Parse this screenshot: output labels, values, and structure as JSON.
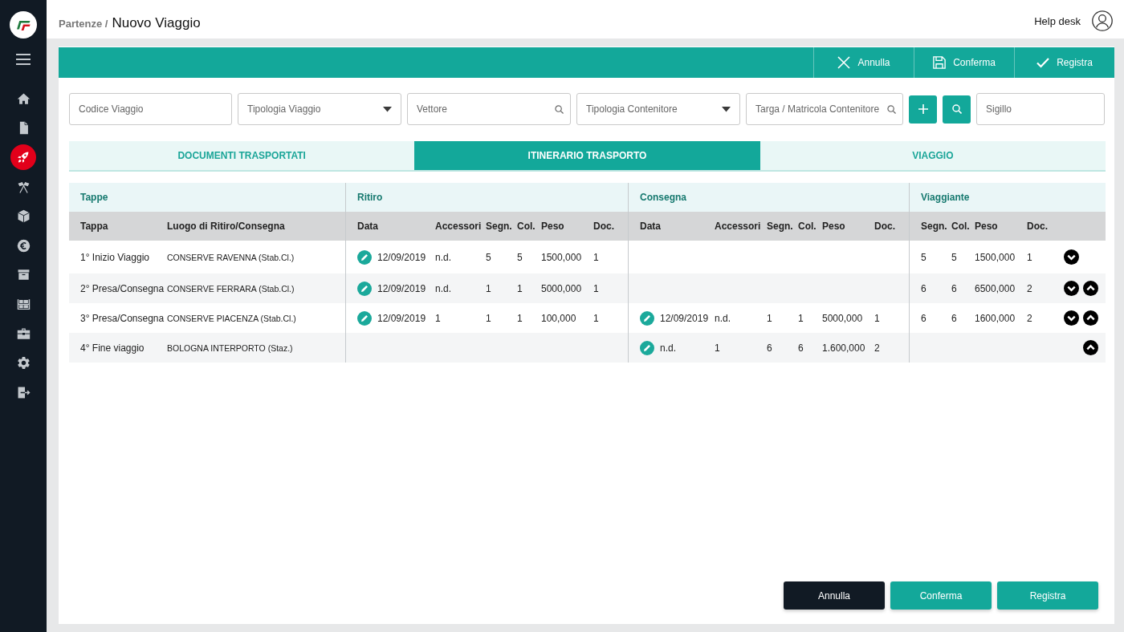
{
  "sidebar": {
    "items": [
      {
        "kind": "home",
        "selected": false
      },
      {
        "kind": "document",
        "selected": false
      },
      {
        "kind": "rocket",
        "selected": true
      },
      {
        "kind": "flags",
        "selected": false
      },
      {
        "kind": "package",
        "selected": false
      },
      {
        "kind": "euro",
        "selected": false
      },
      {
        "kind": "archive",
        "selected": false
      },
      {
        "kind": "shelves",
        "selected": false
      },
      {
        "kind": "briefcase",
        "selected": false
      },
      {
        "kind": "settings",
        "selected": false
      },
      {
        "kind": "logout",
        "selected": false
      }
    ]
  },
  "header": {
    "breadcrumb": "Partenze /",
    "title": "Nuovo Viaggio",
    "help_link": "Help desk"
  },
  "toolbar": {
    "buttons": [
      {
        "kind": "cancel",
        "label": "Annulla"
      },
      {
        "kind": "save",
        "label": "Conferma"
      },
      {
        "kind": "register",
        "label": "Registra"
      }
    ]
  },
  "filters": [
    {
      "kind": "text",
      "placeholder": "Codice Viaggio"
    },
    {
      "kind": "select",
      "placeholder": "Tipologia Viaggio"
    },
    {
      "kind": "search",
      "placeholder": "Vettore"
    },
    {
      "kind": "select",
      "placeholder": "Tipologia Contenitore"
    },
    {
      "kind": "search",
      "placeholder": "Targa / Matricola Contenitore"
    },
    {
      "kind": "add"
    },
    {
      "kind": "find"
    },
    {
      "kind": "text",
      "placeholder": "Sigillo"
    }
  ],
  "tabs": [
    {
      "label": "DOCUMENTI TRASPORTATI",
      "selected": false
    },
    {
      "label": "ITINERARIO TRASPORTO",
      "selected": true
    },
    {
      "label": "VIAGGIO",
      "selected": false
    }
  ],
  "table": {
    "groups": [
      {
        "label": "Tappe",
        "columns": [
          "Tappa",
          "Luogo di Ritiro/Consegna"
        ]
      },
      {
        "label": "Ritiro",
        "columns": [
          "Data",
          "Accessori",
          "Segn.",
          "Col.",
          "Peso",
          "Doc."
        ]
      },
      {
        "label": "Consegna",
        "columns": [
          "Data",
          "Accessori",
          "Segn.",
          "Col.",
          "Peso",
          "Doc."
        ]
      },
      {
        "label": "Viaggiante",
        "columns": [
          "Segn.",
          "Col.",
          "Peso",
          "Doc."
        ]
      }
    ],
    "rows": [
      {
        "tappa": "1° Inizio Viaggio",
        "luogo": "CONSERVE RAVENNA (Stab.Cl.)",
        "ritiro": [
          "12/09/2019",
          "n.d.",
          "5",
          "5",
          "1500,000",
          "1"
        ],
        "viaggiante": [
          "5",
          "5",
          "1500,000",
          "1"
        ],
        "move_down": true,
        "move_up": false
      },
      {
        "tappa": "2° Presa/Consegna",
        "luogo": "CONSERVE FERRARA (Stab.Cl.)",
        "ritiro": [
          "12/09/2019",
          "n.d.",
          "1",
          "1",
          "5000,000",
          "1"
        ],
        "viaggiante": [
          "6",
          "6",
          "6500,000",
          "2"
        ],
        "move_down": true,
        "move_up": true
      },
      {
        "tappa": "3° Presa/Consegna",
        "luogo": "CONSERVE PIACENZA (Stab.Cl.)",
        "ritiro": [
          "12/09/2019",
          "1",
          "1",
          "1",
          "100,000",
          "1"
        ],
        "consegna": [
          "12/09/2019",
          "n.d.",
          "1",
          "1",
          "5000,000",
          "1"
        ],
        "viaggiante": [
          "6",
          "6",
          "1600,000",
          "2"
        ],
        "move_down": true,
        "move_up": true
      },
      {
        "tappa": "4° Fine viaggio",
        "luogo": "BOLOGNA INTERPORTO (Staz.)",
        "consegna": [
          "n.d.",
          "1",
          "6",
          "6",
          "1.600,000",
          "2"
        ],
        "move_down": false,
        "move_up": true
      }
    ]
  },
  "footer": {
    "buttons": [
      {
        "kind": "cancel",
        "label": "Annulla"
      },
      {
        "kind": "confirm",
        "label": "Conferma"
      },
      {
        "kind": "register",
        "label": "Registra"
      }
    ]
  }
}
